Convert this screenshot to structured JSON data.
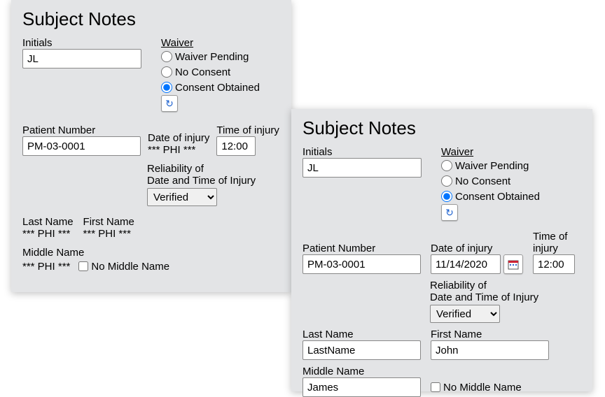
{
  "left": {
    "title": "Subject Notes",
    "initials": {
      "label": "Initials",
      "value": "JL"
    },
    "waiver": {
      "label": "Waiver",
      "options": {
        "pending": "Waiver Pending",
        "none": "No Consent",
        "consent": "Consent Obtained"
      },
      "selected": "consent"
    },
    "patient_number": {
      "label": "Patient Number",
      "value": "PM-03-0001"
    },
    "date_of_injury": {
      "label": "Date of injury",
      "value": "*** PHI ***"
    },
    "time_of_injury": {
      "label": "Time of injury",
      "value": "12:00"
    },
    "reliability": {
      "label1": "Reliability of",
      "label2": "Date and Time of Injury",
      "value": "Verified"
    },
    "last_name": {
      "label": "Last Name",
      "value": "*** PHI ***"
    },
    "first_name": {
      "label": "First Name",
      "value": "*** PHI ***"
    },
    "middle_name": {
      "label": "Middle Name",
      "value": "*** PHI ***"
    },
    "no_middle": {
      "label": "No Middle Name"
    }
  },
  "right": {
    "title": "Subject Notes",
    "initials": {
      "label": "Initials",
      "value": "JL"
    },
    "waiver": {
      "label": "Waiver",
      "options": {
        "pending": "Waiver Pending",
        "none": "No Consent",
        "consent": "Consent Obtained"
      },
      "selected": "consent"
    },
    "patient_number": {
      "label": "Patient Number",
      "value": "PM-03-0001"
    },
    "date_of_injury": {
      "label": "Date of injury",
      "value": "11/14/2020"
    },
    "time_of_injury": {
      "label": "Time of injury",
      "value": "12:00"
    },
    "reliability": {
      "label1": "Reliability of",
      "label2": "Date and Time of Injury",
      "value": "Verified"
    },
    "last_name": {
      "label": "Last Name",
      "value": "LastName"
    },
    "first_name": {
      "label": "First Name",
      "value": "John"
    },
    "middle_name": {
      "label": "Middle Name",
      "value": "James"
    },
    "no_middle": {
      "label": "No Middle Name"
    }
  }
}
